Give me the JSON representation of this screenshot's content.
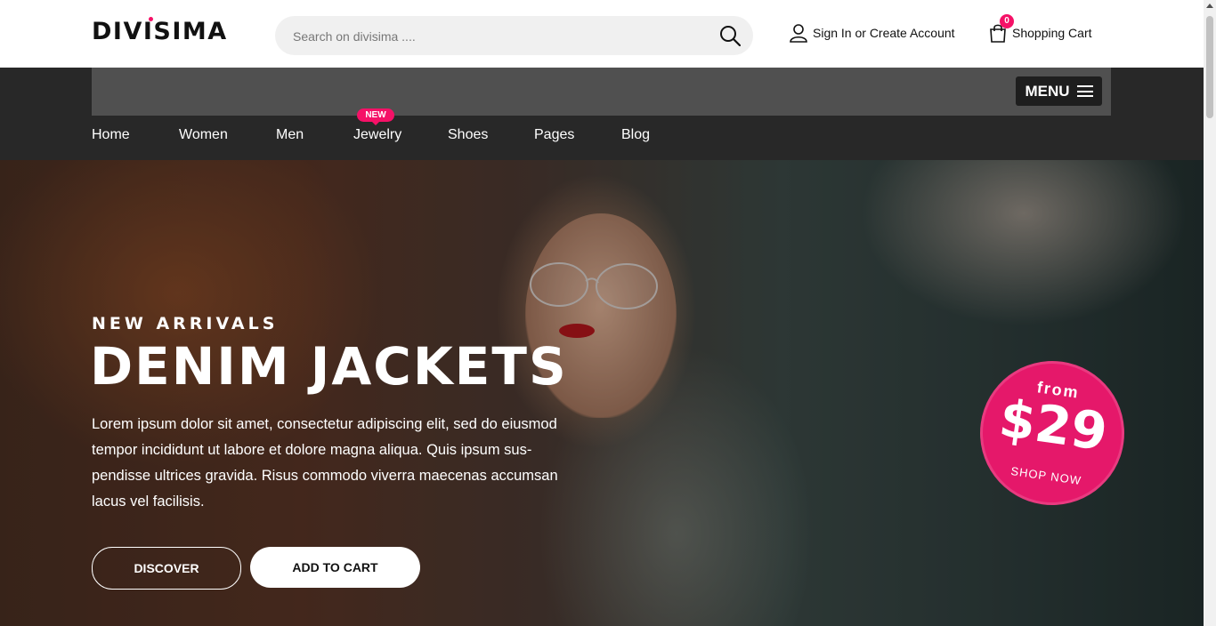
{
  "header": {
    "logo": "DIVISIMA",
    "search_placeholder": "Search on divisima ....",
    "account_label": "Sign In or Create Account",
    "cart_label": "Shopping Cart",
    "cart_count": "0"
  },
  "nav": {
    "menu_label": "MENU",
    "items": [
      "Home",
      "Women",
      "Men",
      "Jewelry",
      "Shoes",
      "Pages",
      "Blog"
    ],
    "new_tag": "NEW"
  },
  "hero": {
    "kicker": "NEW ARRIVALS",
    "title": "DENIM JACKETS",
    "description": "Lorem ipsum dolor sit amet, consectetur adipiscing elit, sed do eiusmod tempor incididunt ut labore et dolore magna aliqua. Quis ipsum sus-pendisse ultrices gravida. Risus commodo viverra maecenas accumsan lacus vel facilisis.",
    "discover_label": "DISCOVER",
    "add_to_cart_label": "ADD TO CART",
    "promo_from": "from",
    "promo_price": "$29",
    "promo_shop": "SHOP NOW"
  },
  "colors": {
    "accent": "#f51167",
    "nav_bg": "#282828",
    "nav_top_bg": "#505050"
  },
  "icons": {
    "search": "search-icon",
    "user": "user-icon",
    "cart": "shopping-bag-icon",
    "menu": "hamburger-icon"
  }
}
